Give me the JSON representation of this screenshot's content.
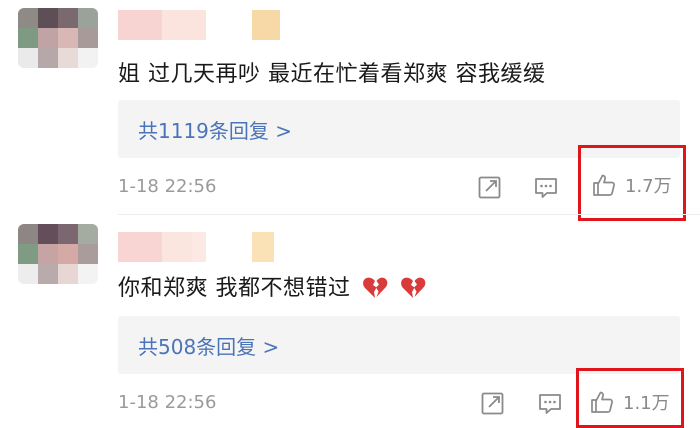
{
  "comments": [
    {
      "text": "姐 过几天再吵 最近在忙着看郑爽 容我缓缓",
      "reply_label": "共1119条回复 >",
      "time": "1-18 22:56",
      "likes": "1.7万",
      "emojis": []
    },
    {
      "text": "你和郑爽 我都不想错过",
      "reply_label": "共508条回复 >",
      "time": "1-18 22:56",
      "likes": "1.1万",
      "emojis": [
        "broken-heart",
        "broken-heart"
      ]
    }
  ],
  "colors": {
    "link": "#4b74b8",
    "highlight_border": "#e0151b",
    "meta_text": "#9a9a9a",
    "reply_bg": "#f4f4f4",
    "broken_heart": "#d93a3a"
  },
  "icons": {
    "share": "share-icon",
    "reply": "comment-icon",
    "like": "thumbs-up-icon"
  }
}
